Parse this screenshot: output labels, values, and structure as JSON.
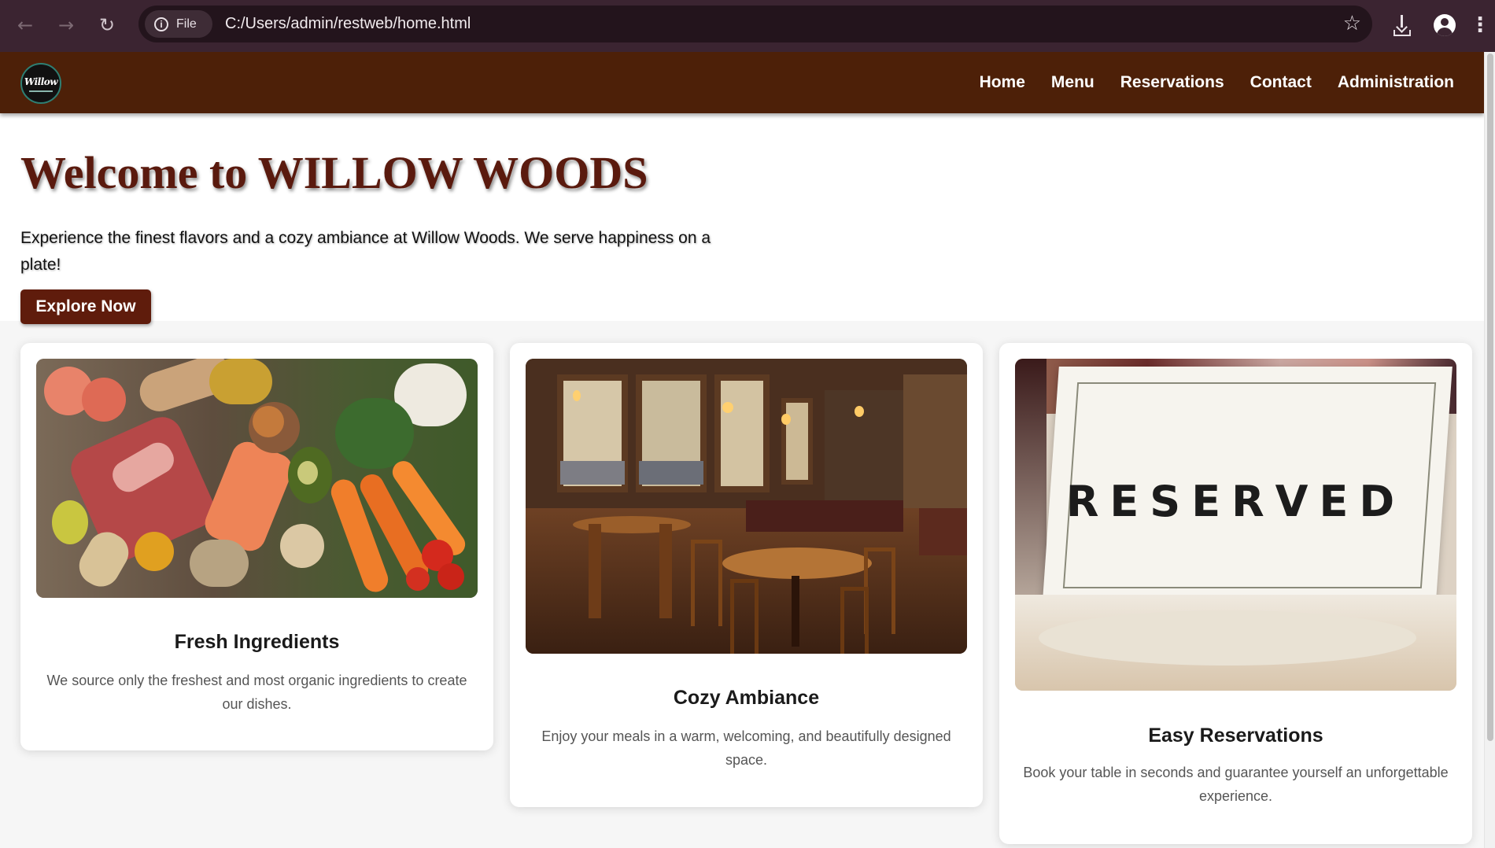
{
  "browser": {
    "back_glyph": "←",
    "forward_glyph": "→",
    "reload_glyph": "↻",
    "site_chip": "File",
    "url": "C:/Users/admin/restweb/home.html",
    "bookmark_glyph": "☆",
    "menu_glyph": "⋮"
  },
  "site": {
    "logo_text": "Willow",
    "nav": [
      "Home",
      "Menu",
      "Reservations",
      "Contact",
      "Administration"
    ]
  },
  "hero": {
    "title": "Welcome to WILLOW WOODS",
    "tagline": "Experience the finest flavors and a cozy ambiance at Willow Woods. We serve happiness on a plate!",
    "cta": "Explore Now"
  },
  "features": [
    {
      "title": "Fresh Ingredients",
      "description": "We source only the freshest and most organic ingredients to create our dishes.",
      "image": "fresh-produce-photo"
    },
    {
      "title": "Cozy Ambiance",
      "description": "Enjoy your meals in a warm, welcoming, and beautifully designed space.",
      "image": "restaurant-interior-photo"
    },
    {
      "title": "Easy Reservations",
      "description": "Book your table in seconds and guarantee yourself an unforgettable experience.",
      "image": "reserved-sign-photo",
      "image_text": "RESERVED"
    }
  ],
  "colors": {
    "nav_bg": "#4d2008",
    "title": "#5a1a0e",
    "button": "#5f1c0c",
    "chrome": "#3b2431"
  }
}
